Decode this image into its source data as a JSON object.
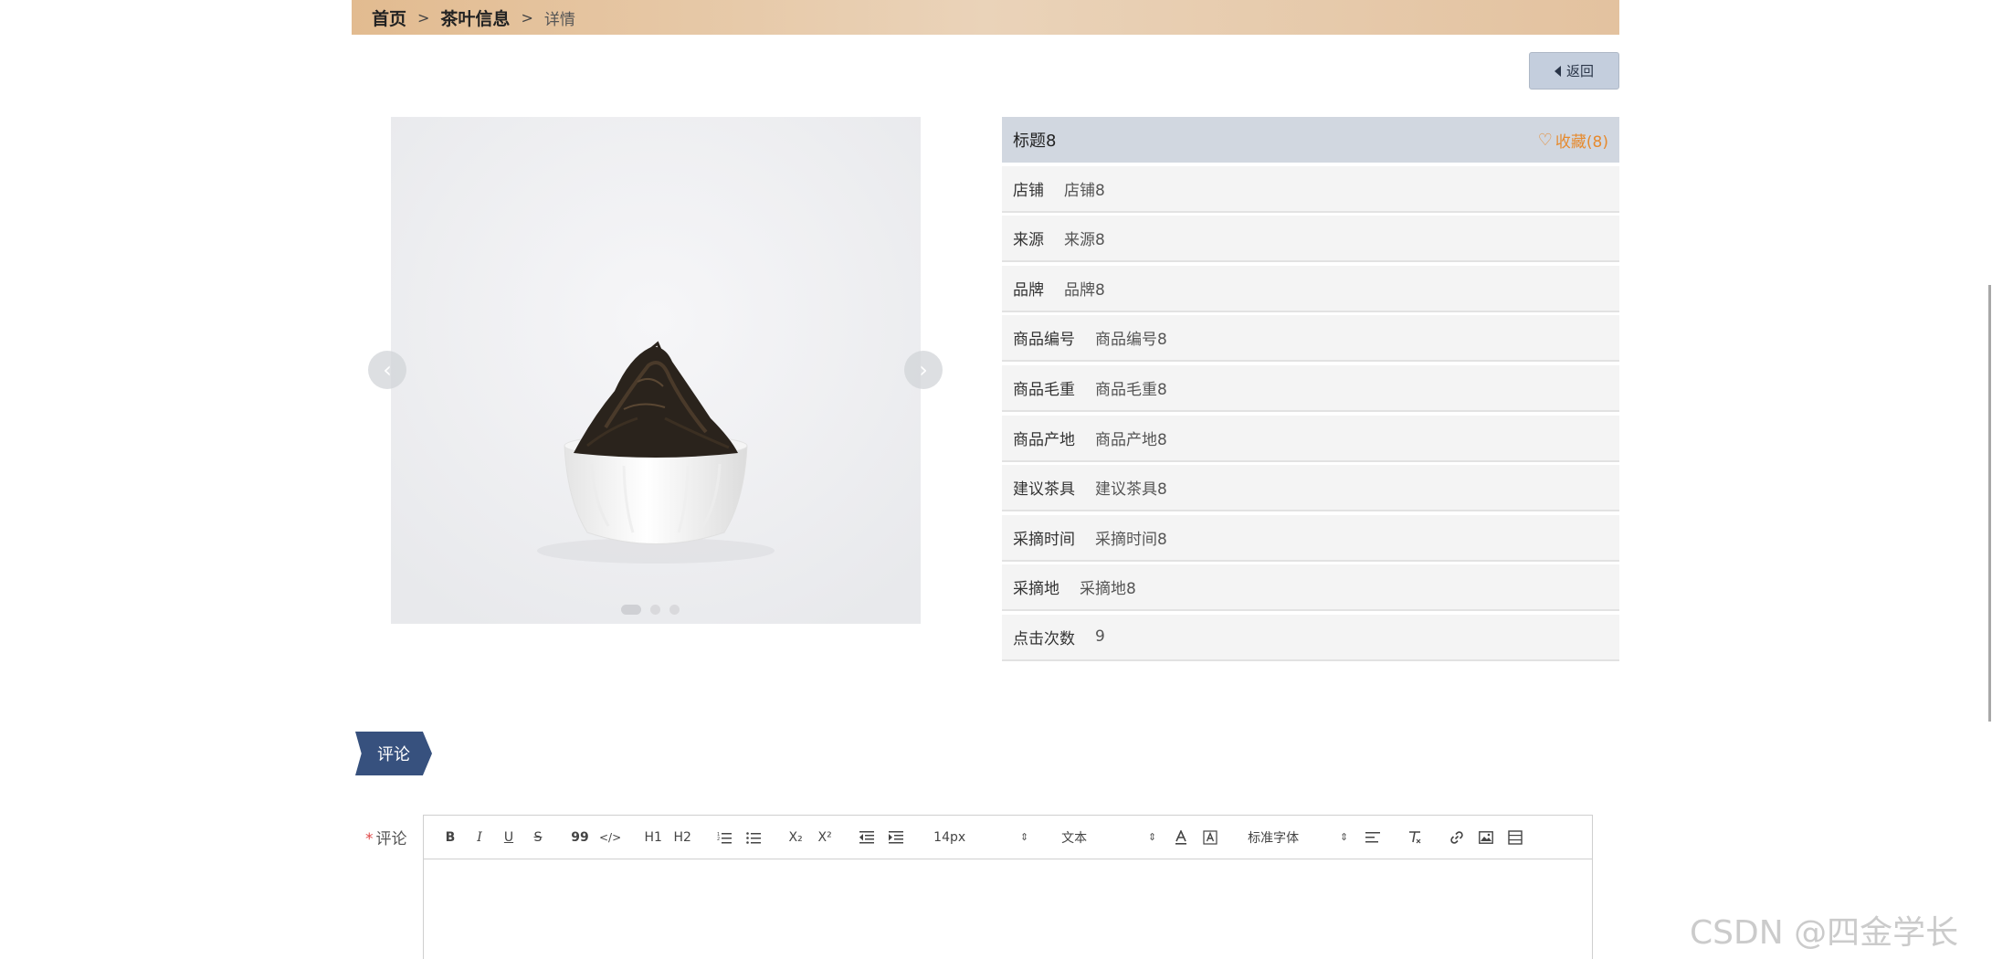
{
  "breadcrumb": {
    "home": "首页",
    "category": "茶叶信息",
    "current": "详情",
    "separator": ">"
  },
  "back_button": {
    "label": "返回",
    "icon": "caret-left-icon"
  },
  "carousel": {
    "prev_icon": "chevron-left-icon",
    "next_icon": "chevron-right-icon",
    "prev_glyph": "‹",
    "next_glyph": "›",
    "slide_count": 3,
    "active_index": 0
  },
  "product": {
    "title": "标题8",
    "favorite_label": "收藏(8)",
    "favorite_icon": "heart-icon",
    "fields": [
      {
        "label": "店铺",
        "value": "店铺8"
      },
      {
        "label": "来源",
        "value": "来源8"
      },
      {
        "label": "品牌",
        "value": "品牌8"
      },
      {
        "label": "商品编号",
        "value": "商品编号8"
      },
      {
        "label": "商品毛重",
        "value": "商品毛重8"
      },
      {
        "label": "商品产地",
        "value": "商品产地8"
      },
      {
        "label": "建议茶具",
        "value": "建议茶具8"
      },
      {
        "label": "采摘时间",
        "value": "采摘时间8"
      },
      {
        "label": "采摘地",
        "value": "采摘地8"
      },
      {
        "label": "点击次数",
        "value": "9"
      }
    ]
  },
  "comment": {
    "section_tag": "评论",
    "field_label": "评论",
    "required_mark": "*",
    "toolbar": {
      "bold": "B",
      "italic": "I",
      "underline": "U",
      "strike": "S",
      "quote": "99",
      "code": "</>",
      "h1": "H1",
      "h2": "H2",
      "subscript": "X₂",
      "superscript": "X²",
      "font_size": "14px",
      "text_type": "文本",
      "font_family": "标准字体",
      "select_caret": "⇕"
    }
  },
  "watermark": "CSDN @四金学长",
  "colors": {
    "breadcrumb_bg": "#e2bb90",
    "accent_orange": "#e68a2e",
    "comment_tag": "#37517e",
    "info_header": "#d1d7e0"
  }
}
